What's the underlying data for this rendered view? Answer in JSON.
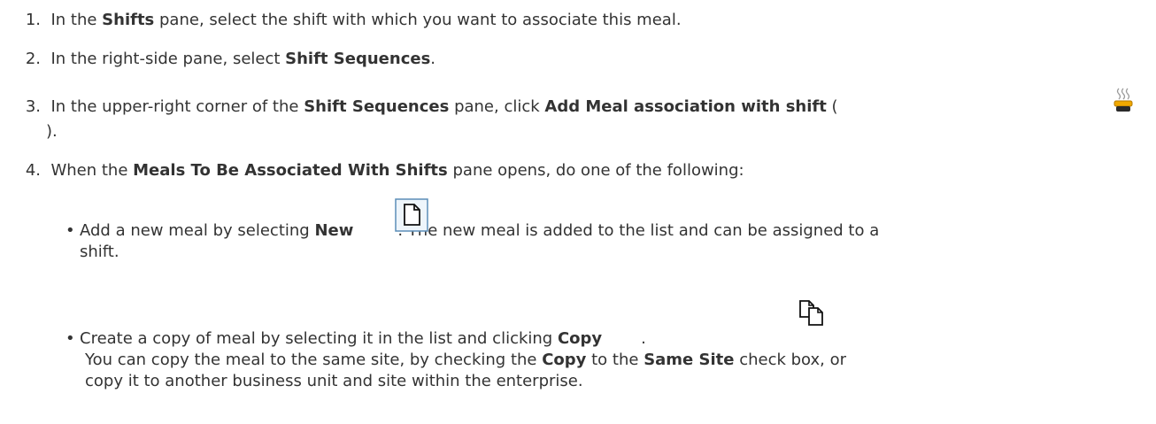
{
  "steps": [
    {
      "number": "1.",
      "text_a": "In the ",
      "bold_a": "Shifts",
      "text_b": " pane, select the shift with which you want to associate this meal."
    },
    {
      "number": "2.",
      "text_a": "In the right-side pane, select ",
      "bold_a": "Shift Sequences",
      "text_b": "."
    },
    {
      "number": "3.",
      "text_a": "In the upper-right corner of the ",
      "bold_a": "Shift Sequences",
      "text_b": " pane, click ",
      "bold_b": "Add Meal association with shift",
      "text_c": " (",
      "text_d": ")."
    },
    {
      "number": "4.",
      "text_a": "When the ",
      "bold_a": "Meals To Be Associated With Shifts",
      "text_b": " pane opens, do one of the following:"
    }
  ],
  "bullets": [
    {
      "marker": "•",
      "text_a": "Add a new meal by selecting ",
      "bold_a": "New",
      "text_b": ". The new meal is added to the list and can be assigned to a",
      "text_c": "shift."
    },
    {
      "marker": "•",
      "text_a": "Create a copy of meal by selecting it in the list and clicking ",
      "bold_a": "Copy",
      "text_b": ".",
      "line2_a": "You can copy the meal to the same site, by checking the ",
      "line2_bold_a": "Copy",
      "line2_b": " to the ",
      "line2_bold_b": "Same Site",
      "line2_c": " check box, or",
      "line3": "copy it to another business unit and site within the enterprise."
    }
  ],
  "icons": {
    "meal": "meal-association-icon",
    "new": "new-document-icon",
    "copy": "copy-document-icon"
  }
}
